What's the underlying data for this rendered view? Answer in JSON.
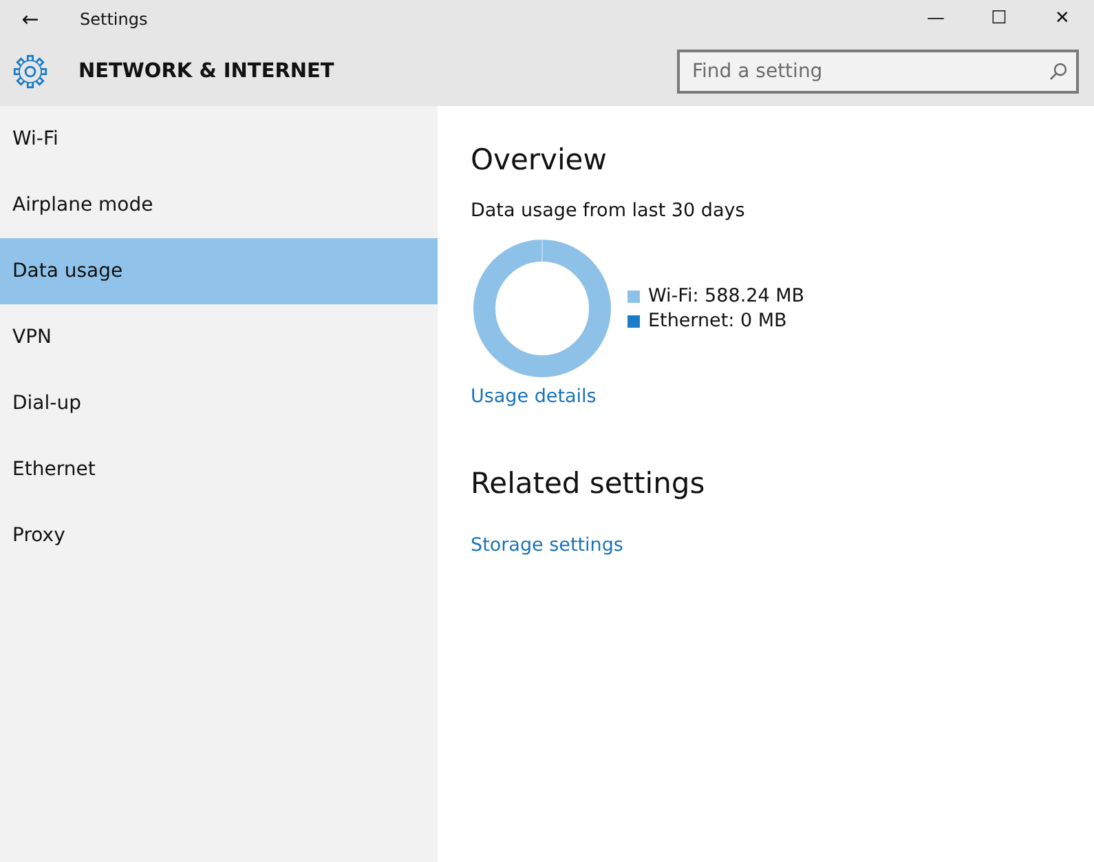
{
  "window": {
    "title": "Settings",
    "back": "←",
    "controls": [
      "—",
      "☐",
      "✕"
    ]
  },
  "header": {
    "title": "NETWORK & INTERNET",
    "search": {
      "placeholder": "Find a setting"
    }
  },
  "sidebar": {
    "items": [
      {
        "label": "Wi-Fi",
        "selected": false
      },
      {
        "label": "Airplane mode",
        "selected": false
      },
      {
        "label": "Data usage",
        "selected": true
      },
      {
        "label": "VPN",
        "selected": false
      },
      {
        "label": "Dial-up",
        "selected": false
      },
      {
        "label": "Ethernet",
        "selected": false
      },
      {
        "label": "Proxy",
        "selected": false
      }
    ]
  },
  "overview": {
    "heading": "Overview",
    "subtitle": "Data usage from last 30 days",
    "legend": [
      {
        "text": "Wi-Fi: 588.24 MB",
        "color": "#8ec1e8"
      },
      {
        "text": "Ethernet: 0 MB",
        "color": "#1b7cc7"
      }
    ],
    "link": "Usage details"
  },
  "related": {
    "heading": "Related settings",
    "links": [
      "Storage settings"
    ]
  }
}
